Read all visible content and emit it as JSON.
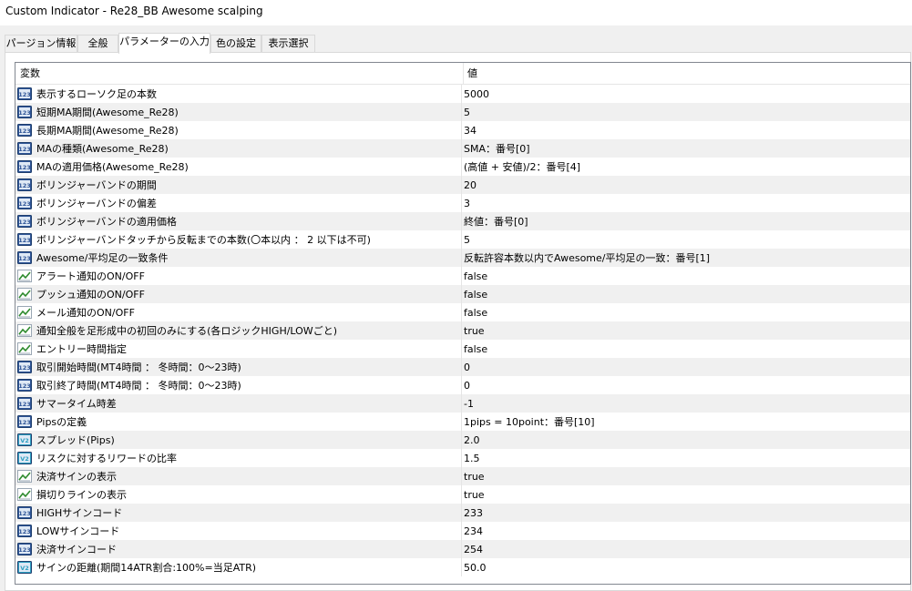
{
  "window": {
    "title": "Custom Indicator - Re28_BB Awesome scalping"
  },
  "tabs": [
    {
      "label": "パージョン情報",
      "active": false
    },
    {
      "label": "全般",
      "active": false
    },
    {
      "label": "パラメーターの入力",
      "active": true
    },
    {
      "label": "色の設定",
      "active": false
    },
    {
      "label": "表示選択",
      "active": false
    }
  ],
  "grid": {
    "columns": [
      "変数",
      "値"
    ],
    "rows": [
      {
        "icon": "int-icon",
        "name": "表示するローソク足の本数",
        "value": "5000"
      },
      {
        "icon": "int-icon",
        "name": "短期MA期間(Awesome_Re28)",
        "value": "5"
      },
      {
        "icon": "int-icon",
        "name": "長期MA期間(Awesome_Re28)",
        "value": "34"
      },
      {
        "icon": "int-icon",
        "name": "MAの種類(Awesome_Re28)",
        "value": "SMA：番号[0]"
      },
      {
        "icon": "int-icon",
        "name": "MAの適用価格(Awesome_Re28)",
        "value": "(高値 + 安値)/2：番号[4]"
      },
      {
        "icon": "int-icon",
        "name": "ボリンジャーバンドの期間",
        "value": "20"
      },
      {
        "icon": "int-icon",
        "name": "ボリンジャーバンドの偏差",
        "value": "3"
      },
      {
        "icon": "int-icon",
        "name": "ボリンジャーバンドの適用価格",
        "value": "終値：番号[0]"
      },
      {
        "icon": "int-icon",
        "name": "ボリンジャーバンドタッチから反転までの本数(〇本以内 ： 2 以下は不可)",
        "value": "5"
      },
      {
        "icon": "int-icon",
        "name": "Awesome/平均足の一致条件",
        "value": "反転許容本数以内でAwesome/平均足の一致：番号[1]"
      },
      {
        "icon": "bool-icon",
        "name": "アラート通知のON/OFF",
        "value": "false"
      },
      {
        "icon": "bool-icon",
        "name": "プッシュ通知のON/OFF",
        "value": "false"
      },
      {
        "icon": "bool-icon",
        "name": "メール通知のON/OFF",
        "value": "false"
      },
      {
        "icon": "bool-icon",
        "name": "通知全般を足形成中の初回のみにする(各ロジックHIGH/LOWごと)",
        "value": "true"
      },
      {
        "icon": "bool-icon",
        "name": "エントリー時間指定",
        "value": "false"
      },
      {
        "icon": "int-icon",
        "name": "取引開始時間(MT4時間 ： 冬時間：0～23時)",
        "value": "0"
      },
      {
        "icon": "int-icon",
        "name": "取引終了時間(MT4時間 ： 冬時間：0～23時)",
        "value": "0"
      },
      {
        "icon": "int-icon",
        "name": "サマータイム時差",
        "value": "-1"
      },
      {
        "icon": "int-icon",
        "name": "Pipsの定義",
        "value": "1pips = 10point：番号[10]"
      },
      {
        "icon": "double-icon",
        "name": "スプレッド(Pips)",
        "value": "2.0"
      },
      {
        "icon": "double-icon",
        "name": "リスクに対するリワードの比率",
        "value": "1.5"
      },
      {
        "icon": "bool-icon",
        "name": "決済サインの表示",
        "value": "true"
      },
      {
        "icon": "bool-icon",
        "name": "損切りラインの表示",
        "value": "true"
      },
      {
        "icon": "int-icon",
        "name": "HIGHサインコード",
        "value": "233"
      },
      {
        "icon": "int-icon",
        "name": "LOWサインコード",
        "value": "234"
      },
      {
        "icon": "int-icon",
        "name": "決済サインコード",
        "value": "254"
      },
      {
        "icon": "double-icon",
        "name": "サインの距離(期間14ATR割合:100%=当足ATR)",
        "value": "50.0"
      }
    ]
  },
  "icon_labels": {
    "int-icon": "123",
    "double-icon": "V2",
    "bool-icon": ""
  },
  "colors": {
    "int_icon_bg": "#2f5597",
    "double_icon_bg": "#2e9fc1",
    "bool_icon_line": "#2e8b2e",
    "alt_row": "#f0f0f0"
  }
}
